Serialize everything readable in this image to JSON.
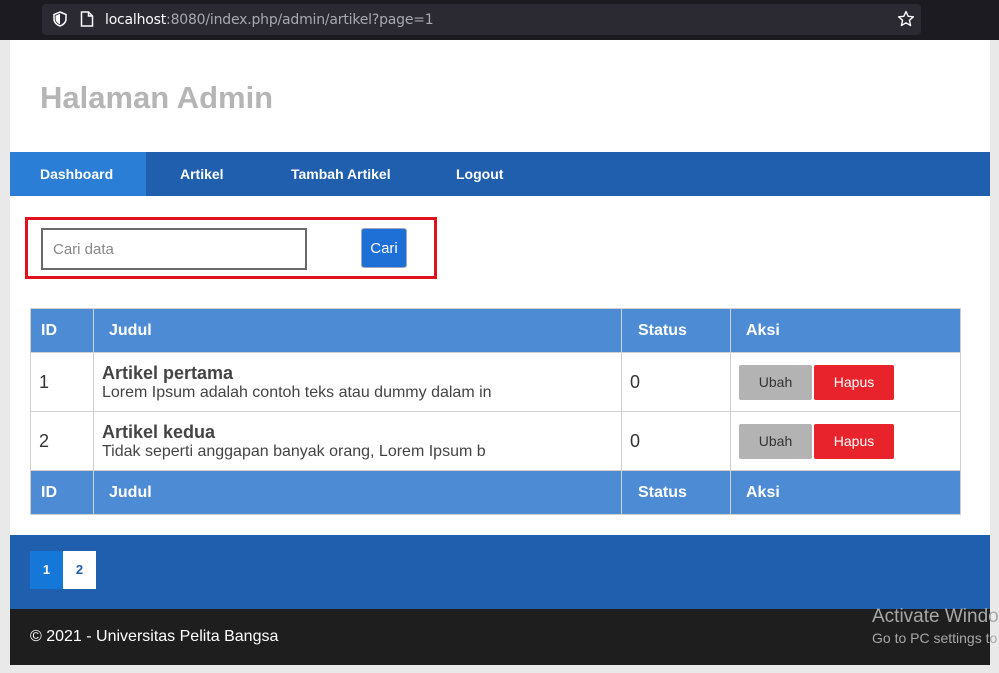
{
  "browser": {
    "url_host": "localhost",
    "url_rest": ":8080/index.php/admin/artikel?page=1"
  },
  "header": {
    "title": "Halaman Admin"
  },
  "nav": {
    "items": [
      {
        "label": "Dashboard"
      },
      {
        "label": "Artikel"
      },
      {
        "label": "Tambah Artikel"
      },
      {
        "label": "Logout"
      }
    ]
  },
  "search": {
    "placeholder": "Cari data",
    "button_label": "Cari"
  },
  "table": {
    "headers": [
      "ID",
      "Judul",
      "Status",
      "Aksi"
    ],
    "rows": [
      {
        "id": "1",
        "title": "Artikel pertama",
        "excerpt": "Lorem Ipsum adalah contoh teks atau dummy dalam in",
        "status": "0",
        "edit": "Ubah",
        "delete": "Hapus"
      },
      {
        "id": "2",
        "title": "Artikel kedua",
        "excerpt": "Tidak seperti anggapan banyak orang, Lorem Ipsum b",
        "status": "0",
        "edit": "Ubah",
        "delete": "Hapus"
      }
    ]
  },
  "pagination": {
    "pages": [
      "1",
      "2"
    ]
  },
  "footer": {
    "text": "© 2021 - Universitas Pelita Bangsa"
  },
  "watermark": {
    "line1": "Activate Windows",
    "line2": "Go to PC settings to activate Windows."
  },
  "colors": {
    "nav": "#1f5fae",
    "table_header": "#4d8bd4",
    "highlight": "#e0121f",
    "delete": "#e8232b"
  }
}
